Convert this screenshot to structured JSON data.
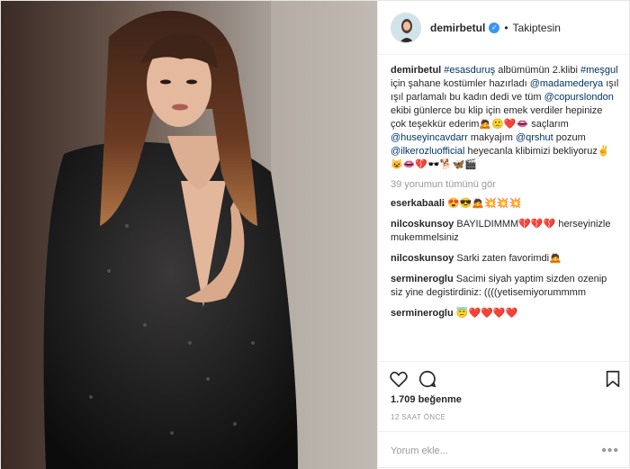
{
  "header": {
    "username": "demirbetul",
    "verified_icon": "verified-badge-icon",
    "separator": "•",
    "follow_status": "Takiptesin"
  },
  "caption": {
    "username": "demirbetul",
    "parts": [
      {
        "text": " "
      },
      {
        "text": "#esasduruş",
        "tag": true
      },
      {
        "text": " albümümün 2.klibi "
      },
      {
        "text": "#meşgul",
        "tag": true
      },
      {
        "text": " için şahane kostümler hazırladı "
      },
      {
        "text": "@madamederya",
        "tag": true
      },
      {
        "text": " ışıl ışıl parlamalı bu kadın dedi ve tüm "
      },
      {
        "text": "@copurslondon",
        "tag": true
      },
      {
        "text": " ekibi günlerce bu klip için emek verdiler hepinize çok teşekkür ederim🙇🙁❤️👄 saçlarım "
      },
      {
        "text": "@huseyincavdarr",
        "tag": true
      },
      {
        "text": " makyajım "
      },
      {
        "text": "@qrshut",
        "tag": true
      },
      {
        "text": " pozum "
      },
      {
        "text": "@ilkerozluofficial",
        "tag": true
      },
      {
        "text": " heyecanla klibimizi bekliyoruz✌️😺👄💔🕶️🐕🦋🎬"
      }
    ]
  },
  "view_all_comments": "39 yorumun tümünü gör",
  "comments": [
    {
      "username": "eserkabaali",
      "text": "😍😎🙇💥💥💥"
    },
    {
      "username": "nilcoskunsoy",
      "text": "BAYILDIMMM💔💔💔 herseyinizle mukemmelsiniz"
    },
    {
      "username": "nilcoskunsoy",
      "text": "Sarki zaten favorimdi🙇"
    },
    {
      "username": "sermineroglu",
      "text": "Sacimi siyah yaptim sizden ozenip siz yine degistirdiniz: ((((yetisemiyorummmm"
    },
    {
      "username": "sermineroglu",
      "text": "😇❤️❤️❤️❤️"
    }
  ],
  "actions": {
    "like_icon": "heart-icon",
    "comment_icon": "comment-bubble-icon",
    "save_icon": "bookmark-icon"
  },
  "likes": "1.709 beğenme",
  "timestamp": "12 SAAT ÖNCE",
  "add_comment": {
    "placeholder": "Yorum ekle...",
    "more_icon": "more-dots-icon",
    "more_label": "•••"
  },
  "colors": {
    "tag": "#003569",
    "muted": "#999999",
    "text": "#262626",
    "verified": "#3897f0"
  }
}
